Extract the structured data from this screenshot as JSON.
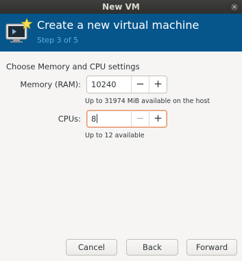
{
  "window": {
    "title": "New VM",
    "close_glyph": "×"
  },
  "header": {
    "title": "Create a new virtual machine",
    "step": "Step 3 of 5",
    "icon": "vm-monitor-icon",
    "background": "#06568c"
  },
  "content": {
    "section_title": "Choose Memory and CPU settings",
    "memory": {
      "label": "Memory (RAM):",
      "value": "10240",
      "decrement": "−",
      "increment": "+",
      "hint": "Up to 31974 MiB available on the host"
    },
    "cpus": {
      "label": "CPUs:",
      "value": "8",
      "decrement": "−",
      "increment": "+",
      "hint": "Up to 12 available"
    }
  },
  "buttons": {
    "cancel": "Cancel",
    "back": "Back",
    "forward": "Forward"
  }
}
